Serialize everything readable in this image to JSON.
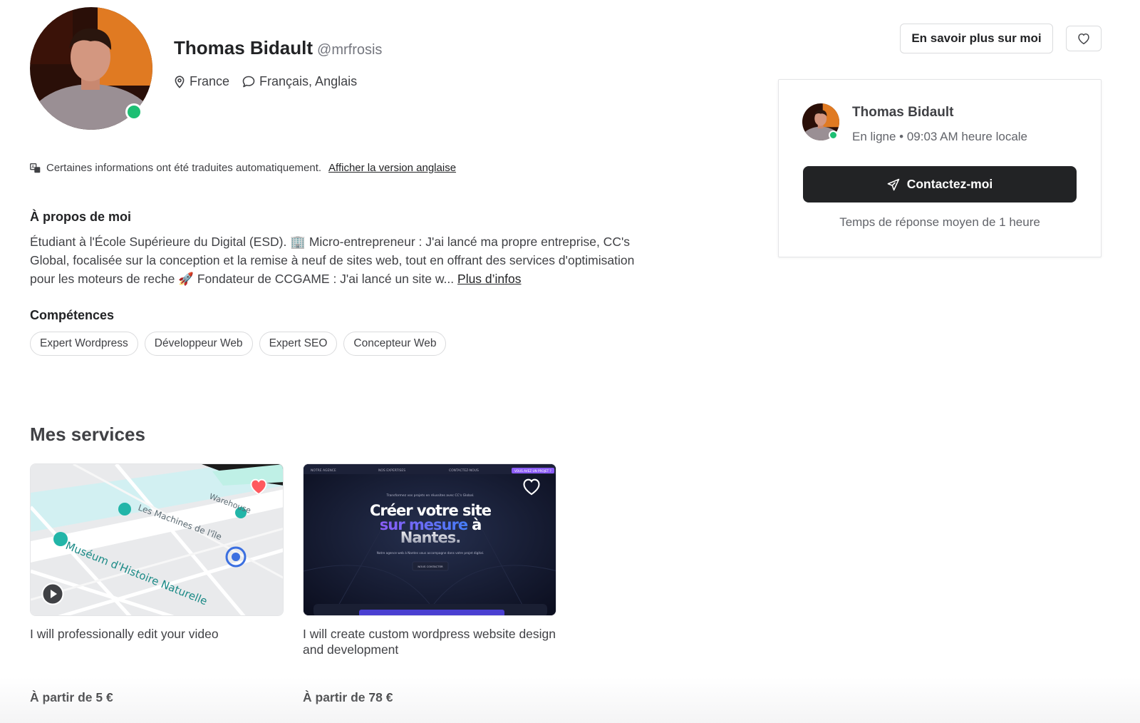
{
  "profile": {
    "name": "Thomas Bidault",
    "handle": "@mrfrosis",
    "country": "France",
    "languages": "Français, Anglais",
    "online": true
  },
  "translation": {
    "notice": "Certaines informations ont été traduites automatiquement.",
    "link": "Afficher la version anglaise"
  },
  "about": {
    "heading": "À propos de moi",
    "text": "Étudiant à l'École Supérieure du Digital (ESD). 🏢 Micro-entrepreneur : J'ai lancé ma propre entreprise, CC's Global, focalisée sur la conception et la remise à neuf de sites web, tout en offrant des services d'optimisation pour les moteurs de reche 🚀 Fondateur de CCGAME : J'ai lancé un site w...",
    "more_link": "Plus d’infos"
  },
  "skills": {
    "heading": "Compétences",
    "items": [
      "Expert Wordpress",
      "Développeur Web",
      "Expert SEO",
      "Concepteur Web"
    ]
  },
  "services": {
    "heading": "Mes services",
    "items": [
      {
        "title": "I will professionally edit your video",
        "price": "À partir de 5 €",
        "favorited": true,
        "map_labels": [
          "Muséum d'Histoire Naturelle",
          "Les Machines de l'île",
          "Warehouse"
        ]
      },
      {
        "title": "I will create custom wordpress website design and development",
        "price": "À partir de 78 €",
        "favorited": false,
        "preview": {
          "nav": [
            "NOTRE AGENCE",
            "NOS EXPERTISES",
            "CONTACTEZ-NOUS",
            "VOUS AVEZ UN PROJET ?"
          ],
          "tagline": "Transformez vos projets en réussites avec CC's Global.",
          "headline_1": "Créer votre site",
          "headline_2a": "sur mesure",
          "headline_2b": "à",
          "headline_3": "Nantes.",
          "sub": "Notre agence web à Nantes vous accompagne dans votre projet digital.",
          "cta": "NOUS CONTACTER"
        }
      }
    ]
  },
  "sidebar": {
    "more_button": "En savoir plus sur moi",
    "card": {
      "name": "Thomas Bidault",
      "status": "En ligne • 09:03 AM heure locale",
      "contact_button": "Contactez-moi",
      "response_time": "Temps de réponse moyen de 1 heure"
    }
  },
  "colors": {
    "online": "#1dbf73",
    "dark_button": "#222325",
    "heart_red": "#ff5a5f",
    "gradient_purple": "#8b5cf6",
    "gradient_blue": "#3b82f6"
  }
}
